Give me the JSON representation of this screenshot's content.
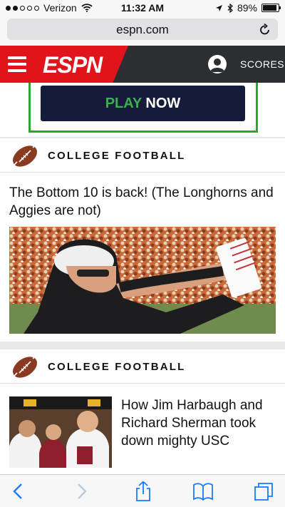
{
  "status_bar": {
    "carrier": "Verizon",
    "time": "11:32 AM",
    "battery": "89%",
    "battery_level": 0.89
  },
  "browser": {
    "url": "espn.com"
  },
  "header": {
    "logo_text": "ESPN",
    "scores_label": "SCORES"
  },
  "promo": {
    "play_text_green": "PLAY",
    "play_text_white": "NOW"
  },
  "articles": [
    {
      "category": "COLLEGE FOOTBALL",
      "headline": "The Bottom 10 is back! (The Longhorns and Aggies are not)"
    },
    {
      "category": "COLLEGE FOOTBALL",
      "headline": "How Jim Harbaugh and Richard Sherman took down mighty USC"
    }
  ],
  "colors": {
    "espn_red": "#e1141c",
    "header_dark": "#2c2e31",
    "promo_navy": "#151b3b",
    "promo_green": "#37b34a",
    "ios_blue": "#1a7cf5"
  },
  "icons": [
    "wifi-icon",
    "location-icon",
    "bluetooth-icon",
    "battery-icon",
    "reload-icon",
    "hamburger-menu-icon",
    "user-avatar-icon",
    "football-icon",
    "back-icon",
    "forward-icon",
    "share-icon",
    "bookmarks-icon",
    "tabs-icon"
  ]
}
